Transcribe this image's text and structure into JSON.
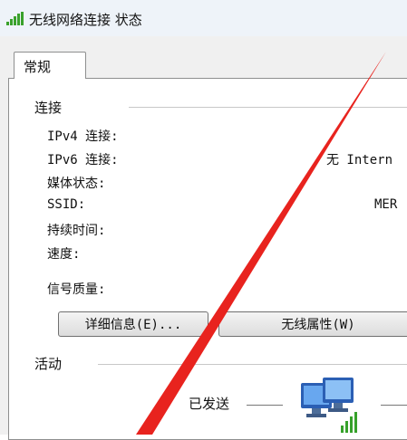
{
  "window": {
    "title": "无线网络连接 状态",
    "icon": "signal-bars-icon"
  },
  "tabs": [
    {
      "label": "常规",
      "selected": true
    }
  ],
  "connection": {
    "section_label": "连接",
    "rows": [
      {
        "label": "IPv4 连接:",
        "value": ""
      },
      {
        "label": "IPv6 连接:",
        "value": "无 Intern"
      },
      {
        "label": "媒体状态:",
        "value": ""
      },
      {
        "label": "SSID:",
        "value": "MER"
      },
      {
        "label": "持续时间:",
        "value": ""
      },
      {
        "label": "速度:",
        "value": ""
      }
    ],
    "signal_label": "信号质量:"
  },
  "buttons": {
    "details": "详细信息(E)...",
    "wireless_properties": "无线属性(W)"
  },
  "activity": {
    "section_label": "活动",
    "sent_label": "已发送",
    "icon": "network-computers-icon"
  },
  "annotation": {
    "color": "#e8231e"
  }
}
